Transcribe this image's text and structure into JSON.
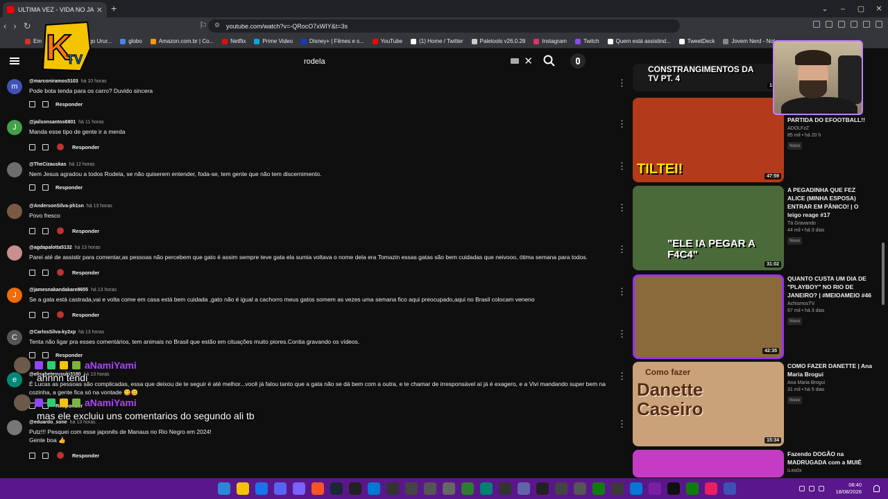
{
  "browser": {
    "tab_title": "ULTIMA VEZ - VIDA NO JAPÃO -",
    "url": "youtube.com/watch?v=-QRocO7xWIY&t=3s"
  },
  "bookmarks": [
    {
      "label": "Em",
      "color": "#d93025"
    },
    {
      "label": "Email – Thiago Urur...",
      "color": "#1a73e8"
    },
    {
      "label": "globo",
      "color": "#4285f4"
    },
    {
      "label": "Amazon.com.br | Co...",
      "color": "#ff9900"
    },
    {
      "label": "Netflix",
      "color": "#e50914"
    },
    {
      "label": "Prime Video",
      "color": "#00a8e1"
    },
    {
      "label": "Disney+ | Filmes e s...",
      "color": "#113ccf"
    },
    {
      "label": "YouTube",
      "color": "#ff0000"
    },
    {
      "label": "(1) Home / Twitter",
      "color": "#ffffff"
    },
    {
      "label": "Paletools v26.0.28",
      "color": "#cccccc"
    },
    {
      "label": "Instagram",
      "color": "#e1306c"
    },
    {
      "label": "Twitch",
      "color": "#9146ff"
    },
    {
      "label": "Quem está assistind...",
      "color": "#ffffff"
    },
    {
      "label": "TweetDeck",
      "color": "#ffffff"
    },
    {
      "label": "Jovem Nerd - Not...",
      "color": "#888888"
    }
  ],
  "search": {
    "value": "rodela"
  },
  "comments": [
    {
      "author": "@marconiramos5103",
      "time": "há 10 horas",
      "text": "Pode bota tenda para os carro? Duvido sincera",
      "avatar": "m",
      "color": "#3f51b5",
      "heart": false,
      "reply": "Responder"
    },
    {
      "author": "@jailsonsantos6801",
      "time": "há 11 horas",
      "text": "Manda esse tipo de gente ir a merda",
      "avatar": "J",
      "color": "#43a047",
      "heart": true,
      "reply": "Responder"
    },
    {
      "author": "@TheCizauskas",
      "time": "há 12 horas",
      "text": "Nem Jesus agradou a todos Rodela, se não quiserem entender, foda-se, tem gente que não tem discernimento.",
      "avatar": "",
      "color": "#6d6d6d",
      "heart": false,
      "reply": "Responder"
    },
    {
      "author": "@AndersonSilva-ph1sn",
      "time": "há 13 horas",
      "text": "Povo fresco",
      "avatar": "",
      "color": "#7a5a45",
      "heart": true,
      "reply": "Responder"
    },
    {
      "author": "@agdapalotta5132",
      "time": "há 13 horas",
      "text": "Parei até de assistir para  comentar,as pessoas não percebem que gato é assim sempre teve gata ela sumia voltava o nome dela era Tomazin essas gatas são bem cuidadas que neivooo, ótima semana para todos.",
      "avatar": "",
      "color": "#c98f8f",
      "heart": true,
      "reply": "Responder"
    },
    {
      "author": "@jamesnakandakare8655",
      "time": "há 13 horas",
      "text": "Se a gata está castrada,vai e volta come em casa está bem cuidada ,gato não é igual a cachorro meus gatos somem as vezes uma semana fico aqui preocupado,aqui no Brasil colocam veneno",
      "avatar": "J",
      "color": "#ef6c00",
      "heart": true,
      "reply": "Responder"
    },
    {
      "author": "@CarlosSilva-ky2xp",
      "time": "há 13 horas",
      "text": "Tenta não ligar pra esses comentários, tem animais no Brasil que estão em cituações muito piores.Contia gravando os vídeos.",
      "avatar": "C",
      "color": "#555555",
      "heart": false,
      "reply": "Responder"
    },
    {
      "author": "@elisabeteyusuki3180",
      "time": "há 13 horas",
      "text": "É  Lucas as pessoas são complicadas, essa que deixou de te seguir é até melhor...você já falou tanto que a gata não se dá bem com a outra, e  te chamar de irresponsável aí já é exagero, e a Vivi mandando super bem na cozinha, a gente fica só  na vontade 😋😊",
      "avatar": "e",
      "color": "#00897b",
      "heart": false,
      "reply": "Responder"
    },
    {
      "author": "@eduardo_sone",
      "time": "há 13 horas",
      "text": "Putz!!! Pesquei com esse japonês de Manaus no Rio Negro em 2024!\nGente boa 👍",
      "avatar": "",
      "color": "#777777",
      "heart": true,
      "reply": "Responder"
    }
  ],
  "chat": [
    {
      "name": "aNamiYami",
      "message": "ahnnn tendi"
    },
    {
      "name": "aNamiYami",
      "message": "mas ele excluiu uns comentarios do segundo ali tb"
    }
  ],
  "videos": [
    {
      "title": "",
      "channel": "",
      "views": "",
      "duration": "1:45",
      "thumb_text": "CONSTRANGIMENTOS DA TV PT. 4",
      "bg": "#1a1a1a"
    },
    {
      "title": "PARTIDA DO EFOOTBALL!!",
      "channel": "ADOLFzZ",
      "views": "85 mil • há 20 h",
      "duration": "47:59",
      "thumb_text": "TILTEI!",
      "bg": "#b33a1a",
      "badge": "Novo"
    },
    {
      "title": "A PEGADINHA QUE FEZ ALICE (MINHA ESPOSA) ENTRAR EM PÂNICO! | O leigo reage #17",
      "channel": "Tá Gravando",
      "views": "44 mil • há 3 dias",
      "duration": "31:02",
      "thumb_text": "\"ELE IA PEGAR A F4C4\"",
      "bg": "#4b6a3a",
      "badge": "Novo"
    },
    {
      "title": "QUANTO CUSTA UM DIA DE \"PLAYBOY\" NO RIO DE JANEIRO? | #MEIOAMEIO #46",
      "channel": "AchismosTV",
      "views": "67 mil • há 3 dias",
      "duration": "42:35",
      "thumb_text": "",
      "bg": "#8a6a3a",
      "badge": "Novo"
    },
    {
      "title": "COMO FAZER DANETTE | Ana Maria Brogui",
      "channel": "Ana Maria Brogui",
      "views": "31 mil • há 5 dias",
      "duration": "15:34",
      "thumb_text": "Danette Caseiro",
      "bg": "#c9a27a",
      "badge": "Novo",
      "thumb_sub": "Como fazer"
    },
    {
      "title": "Fazendo DOGÃO na MADRUGADA com a MUIÉ",
      "channel": "iLeo0x",
      "views": "",
      "duration": "",
      "thumb_text": "",
      "bg": "#c43cc4"
    }
  ],
  "clock": {
    "time": "08:40",
    "date": "18/08/2026"
  }
}
